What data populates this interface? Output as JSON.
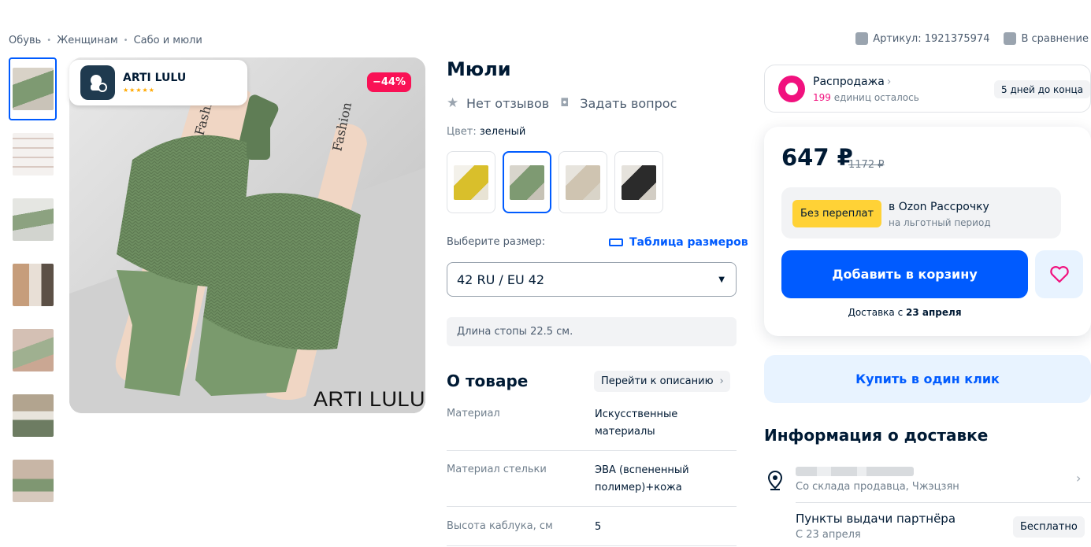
{
  "breadcrumb": [
    "Обувь",
    "Женщинам",
    "Сабо и мюли"
  ],
  "article": {
    "label": "Артикул: 1921375974",
    "compare": "В сравнение"
  },
  "thumbnails": [
    {
      "color": "#8ba07a"
    },
    {
      "color": "#f1eceb"
    },
    {
      "color": "#a9b39f"
    },
    {
      "color": "#c1a38b"
    },
    {
      "color": "#b79c89"
    },
    {
      "color": "#8f8675"
    },
    {
      "color": "#9e8f80"
    }
  ],
  "photo": {
    "brand_name": "ARTI LULU",
    "stars": "★★★★★",
    "discount": "−44%",
    "watermark": "ARTI LULU"
  },
  "product": {
    "title": "Мюли",
    "reviews": "Нет отзывов",
    "ask": "Задать вопрос",
    "color_label": "Цвет:",
    "color_value": "зеленый",
    "swatches": [
      {
        "color": "#d9bf2b"
      },
      {
        "color": "#7e9a72"
      },
      {
        "color": "#cfc4b1"
      },
      {
        "color": "#2b2b2b"
      }
    ],
    "size_label": "Выберите размер:",
    "size_table": "Таблица размеров",
    "size_selected": "42 RU / EU 42",
    "foot_length": "Длина стопы 22.5 см.",
    "about_title": "О товаре",
    "to_description": "Перейти к описанию",
    "specs": [
      {
        "key": "Материал",
        "value": "Искусственные материалы"
      },
      {
        "key": "Материал стельки",
        "value": "ЭВА (вспененный полимер)+кожа"
      },
      {
        "key": "Высота каблука, см",
        "value": "5"
      }
    ]
  },
  "sale": {
    "title": "Распродажа",
    "remaining_count": "199",
    "remaining_text": "единиц осталось",
    "days_left": "5 дней до конца"
  },
  "price": {
    "current": "647 ₽",
    "old": "1172 ₽",
    "no_overpay": "Без переплат",
    "installment_title": "в Ozon Рассрочку",
    "installment_sub": "на льготный период",
    "add_to_cart": "Добавить в корзину",
    "delivery_prefix": "Доставка с",
    "delivery_date": "23 апреля",
    "one_click": "Купить в один клик"
  },
  "delivery_info": {
    "title": "Информация о доставке",
    "from_store": "Со склада продавца, Чжэцзян",
    "pickup_title": "Пункты выдачи партнёра",
    "pickup_date": "С 23 апреля",
    "pickup_price": "Бесплатно"
  },
  "colors": {
    "accent": "#005bff",
    "sale_pink": "#f1117e",
    "discount_red": "#f91155",
    "yellow_badge": "#ffd236"
  }
}
